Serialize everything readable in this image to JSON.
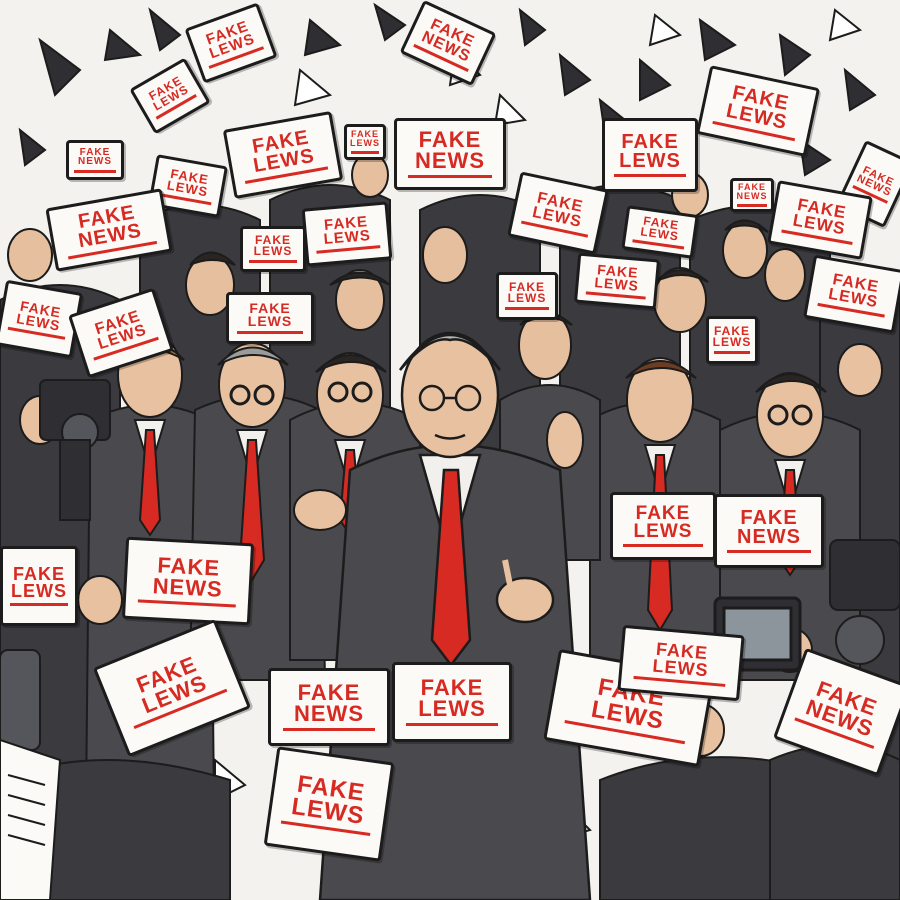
{
  "scene": {
    "palette": {
      "background": "#f4f2ee",
      "suit": "#4a4a4e",
      "suit_dark": "#2e2e33",
      "shirt": "#f1f0ec",
      "tie": "#d62a22",
      "skin": "#e8c2a0",
      "hair_grey": "#9b9b9b",
      "hair_dark": "#2a2523",
      "sign_text": "#d62a22",
      "sign_bg": "#fbfaf7",
      "confetti": "#2f2f33"
    },
    "signs": [
      {
        "l1": "FAKE",
        "l2": "LEWS"
      },
      {
        "l1": "FAKE",
        "l2": "NEWS"
      },
      {
        "l1": "FAKE",
        "l2": "LEWS"
      },
      {
        "l1": "FAKE",
        "l2": "NEWS"
      },
      {
        "l1": "FAKE",
        "l2": "LEWS"
      },
      {
        "l1": "FAKE",
        "l2": "LEWS"
      },
      {
        "l1": "FAKE",
        "l2": "NEWS"
      },
      {
        "l1": "FAKE",
        "l2": "LEWS"
      },
      {
        "l1": "FAKE",
        "l2": "LEWS"
      },
      {
        "l1": "FAKE",
        "l2": "NEWS"
      },
      {
        "l1": "FAKE",
        "l2": "LEWS"
      },
      {
        "l1": "FAKE",
        "l2": "NEWS"
      },
      {
        "l1": "FAKE",
        "l2": "LEWS"
      },
      {
        "l1": "FAKE",
        "l2": "LEWS"
      },
      {
        "l1": "FAKE",
        "l2": "NEWS"
      },
      {
        "l1": "FAKE",
        "l2": "LEWS"
      },
      {
        "l1": "FAKE",
        "l2": "LEWS"
      },
      {
        "l1": "FAKE",
        "l2": "LEWS"
      },
      {
        "l1": "FAKE",
        "l2": "LEWS"
      },
      {
        "l1": "FAKE",
        "l2": "LEWS"
      },
      {
        "l1": "FAKE",
        "l2": "LEWS"
      },
      {
        "l1": "FAKE",
        "l2": "LEWS"
      },
      {
        "l1": "FAKE",
        "l2": "LEWS"
      },
      {
        "l1": "FAKE",
        "l2": "LEWS"
      },
      {
        "l1": "FAKE",
        "l2": "LEWS"
      },
      {
        "l1": "FAKE",
        "l2": "LEWS"
      },
      {
        "l1": "FAKE",
        "l2": "NEWS"
      },
      {
        "l1": "FAKE",
        "l2": "NEWS"
      },
      {
        "l1": "FAKE",
        "l2": "LEWS"
      },
      {
        "l1": "FAKE",
        "l2": "LEWS"
      },
      {
        "l1": "FAKE",
        "l2": "NEWS"
      },
      {
        "l1": "FAKE",
        "l2": "LEWS"
      },
      {
        "l1": "FAKE",
        "l2": "LEWS"
      }
    ]
  }
}
